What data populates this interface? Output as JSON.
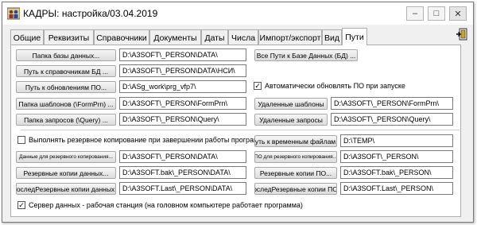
{
  "window": {
    "title": "КАДРЫ: настройка/03.04.2019",
    "minimize_glyph": "–",
    "maximize_glyph": "□",
    "close_glyph": "✕"
  },
  "tabs": [
    "Общие",
    "Реквизиты",
    "Справочники",
    "Документы",
    "Даты",
    "Числа",
    "Импорт/экспорт",
    "Вид",
    "Пути"
  ],
  "active_tab": "Пути",
  "icons": {
    "app": "people-app-icon",
    "exit": "exit-door-icon"
  },
  "paths": {
    "db_folder_btn": "Папка базы данных...",
    "db_folder_val": "D:\\A3SOFT\\_PERSON\\DATA\\",
    "all_paths_btn": "Все Пути к Базе Данных (БД) ...",
    "ref_path_btn": "Путь к справочникам БД ...",
    "ref_path_val": "D:\\A3SOFT\\_PERSON\\DATA\\НСИ\\",
    "upd_path_btn": "Путь к обновлениям ПО...",
    "upd_path_val": "D:\\ASg_work\\prg_vfp7\\",
    "auto_update_label": "Автоматически обновлять ПО при запуске",
    "auto_update_checked": true,
    "tpl_btn": "Папка шаблонов (\\FormPrn) ...",
    "tpl_val": "D:\\A3SOFT\\_PERSON\\FormPrn\\",
    "remote_tpl_btn": "Удаленные шаблоны",
    "remote_tpl_val": "D:\\A3SOFT\\_PERSON\\FormPrn\\",
    "query_btn": "Папка запросов (\\Query) ...",
    "query_val": "D:\\A3SOFT\\_PERSON\\Query\\",
    "remote_query_btn": "Удаленные запросы",
    "remote_query_val": "D:\\A3SOFT\\_PERSON\\Query\\",
    "backup_on_exit_label": "Выполнять резервное копирование при завершении работы программы",
    "backup_on_exit_checked": false,
    "temp_btn": "Путь к временным файлам...",
    "temp_val": "D:\\TEMP\\",
    "backup_data_btn": "Данные для резервного копирования...",
    "backup_data_val": "D:\\A3SOFT\\_PERSON\\DATA\\",
    "backup_sw_btn": "ПО для резервного копирования...",
    "backup_sw_val": "D:\\A3SOFT\\_PERSON\\",
    "bak_data_btn": "Резервные копии данных...",
    "bak_data_val": "D:\\A3SOFT.bak\\_PERSON\\DATA\\",
    "bak_sw_btn": "Резервные копии ПО...",
    "bak_sw_val": "D:\\A3SOFT.bak\\_PERSON\\",
    "last_data_btn": "ПоследРезервные копии данных...",
    "last_data_val": "D:\\A3SOFT.Last\\_PERSON\\DATA\\",
    "last_sw_btn": "ПоследРезервные копии ПО...",
    "last_sw_val": "D:\\A3SOFT.Last\\_PERSON\\",
    "server_label": "Сервер данных - рабочая станция (на головном компьютере работает программа)",
    "server_checked": true
  }
}
